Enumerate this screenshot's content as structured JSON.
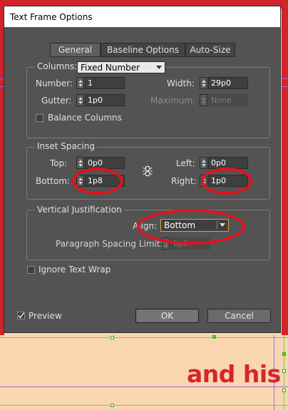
{
  "dialog": {
    "title": "Text Frame Options",
    "tabs": [
      {
        "label": "General",
        "active": true
      },
      {
        "label": "Baseline Options",
        "active": false
      },
      {
        "label": "Auto-Size",
        "active": false
      }
    ],
    "columns": {
      "legend": "Columns:",
      "type_value": "Fixed Number",
      "number_label": "Number:",
      "number_value": "1",
      "width_label": "Width:",
      "width_value": "29p0",
      "gutter_label": "Gutter:",
      "gutter_value": "1p0",
      "maximum_label": "Maximum:",
      "maximum_value": "None",
      "balance_label": "Balance Columns",
      "balance_checked": false
    },
    "inset": {
      "legend": "Inset Spacing",
      "top_label": "Top:",
      "top_value": "0p0",
      "bottom_label": "Bottom:",
      "bottom_value": "1p8",
      "left_label": "Left:",
      "left_value": "0p0",
      "right_label": "Right:",
      "right_value": "1p0",
      "link_icon": "chain-link-icon"
    },
    "vertical": {
      "legend": "Vertical Justification",
      "align_label": "Align:",
      "align_value": "Bottom",
      "para_spacing_label": "Paragraph Spacing Limit:",
      "para_spacing_value": "0p0"
    },
    "ignore_wrap_label": "Ignore Text Wrap",
    "ignore_wrap_checked": false,
    "preview_label": "Preview",
    "preview_checked": true,
    "ok_label": "OK",
    "cancel_label": "Cancel"
  },
  "document_text": "and his",
  "colors": {
    "dialog_bg": "#535353",
    "annotation_red": "#e3121c",
    "document_bg": "#f9d6b0",
    "document_text": "#d5262e",
    "focus_orange": "#e09f3a"
  }
}
